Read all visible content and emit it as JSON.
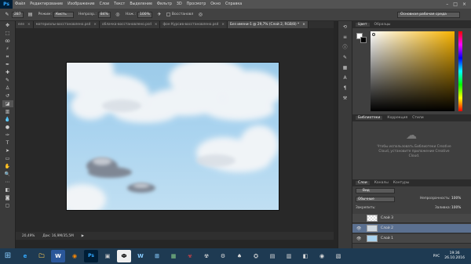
{
  "app": {
    "logo": "Ps"
  },
  "menu": [
    "Файл",
    "Редактирование",
    "Изображение",
    "Слои",
    "Текст",
    "Выделение",
    "Фильтр",
    "3D",
    "Просмотр",
    "Окно",
    "Справка"
  ],
  "window_controls": [
    "–",
    "□",
    "×"
  ],
  "options": {
    "brush_size": "287",
    "mode_label": "Режим:",
    "mode_value": "Кисть",
    "opacity_label": "Непрозр.:",
    "opacity_value": "84%",
    "flow_label": "Наж.:",
    "flow_value": "100%",
    "restore_label": "Восстановл",
    "workspace": "Основная рабочая среда"
  },
  "tabs": [
    {
      "label": "еле",
      "close": "×",
      "active": false
    },
    {
      "label": "материалы-восстановлено.psd",
      "close": "×",
      "active": false
    },
    {
      "label": "облачка-восстановлено.psd",
      "close": "×",
      "active": false
    },
    {
      "label": "фон Курсив-восстановлено.psd",
      "close": "×",
      "active": false
    },
    {
      "label": "Без имени-1 @ 29,7% (Слой 2, RGB/8) *",
      "close": "×",
      "active": true
    }
  ],
  "status": {
    "zoom": "20,49%",
    "doc": "Док: 16,9M/35,5M",
    "arrow": "▶"
  },
  "panels": {
    "color_tabs": [
      "Цвет",
      "Образцы"
    ],
    "library_tabs": [
      "Библиотеки",
      "Коррекция",
      "Стили"
    ],
    "library_message": "Чтобы использовать Библиотеки Creative Cloud, установите приложение Creative Cloud.",
    "layers_tabs": [
      "Слои",
      "Каналы",
      "Контуры"
    ],
    "kind_filter": "Вид",
    "blend_mode": "Обычные",
    "opacity_label": "Непрозрачность:",
    "opacity_value": "100%",
    "lock_label": "Закрепить:",
    "fill_label": "Заливка:",
    "fill_value": "100%",
    "layers": [
      {
        "name": "Слой 3",
        "visible": false,
        "selected": false
      },
      {
        "name": "Слой 2",
        "visible": true,
        "selected": true
      },
      {
        "name": "Слой 1",
        "visible": true,
        "selected": false
      }
    ]
  },
  "taskbar": {
    "apps": [
      "e",
      "🗀",
      "W",
      "◉",
      "Ps",
      "▣",
      "Ф",
      "W",
      "⊞",
      "▦",
      "☣",
      "☢",
      "⚙",
      "♠",
      "⛭",
      "▤",
      "▥",
      "◧",
      "◉",
      "▧"
    ],
    "lang": "РУС",
    "time": "19:36",
    "date": "26.10.2016"
  },
  "colors": {
    "accent": "#31a8ff",
    "selected_layer": "#5b7090",
    "picker_hue": "#f7b300"
  }
}
